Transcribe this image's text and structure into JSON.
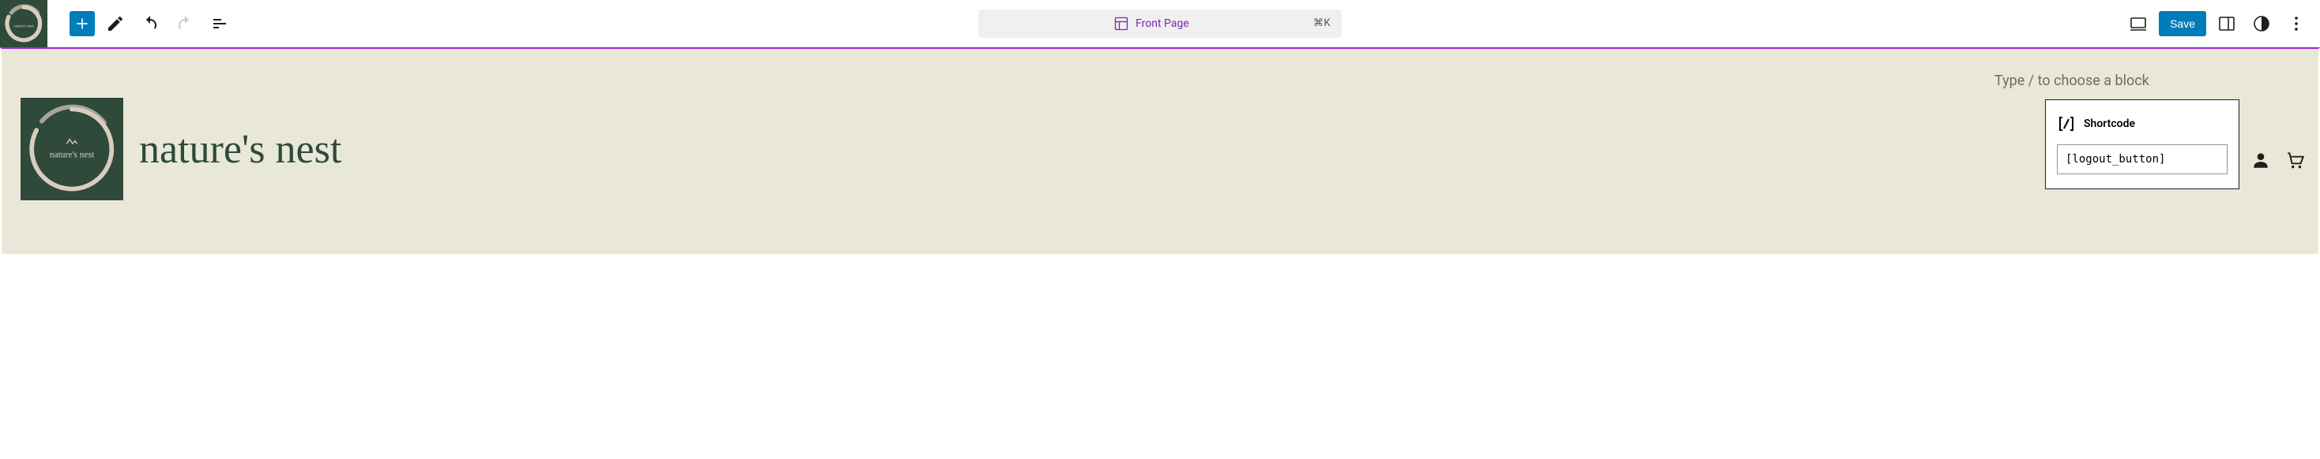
{
  "toolbar": {
    "page_label": "Front Page",
    "shortcut": "⌘K",
    "save_label": "Save"
  },
  "canvas": {
    "site_title": "nature's nest",
    "placeholder_hint": "Type / to choose a block"
  },
  "shortcode_block": {
    "title": "Shortcode",
    "value": "[logout_button]"
  },
  "logo": {
    "inner_text": "nature's nest"
  },
  "colors": {
    "accent": "#007cba",
    "brand_bg": "#2f4a3a",
    "canvas_bg": "#e9e8d8",
    "page_purple": "#7e27b3"
  }
}
